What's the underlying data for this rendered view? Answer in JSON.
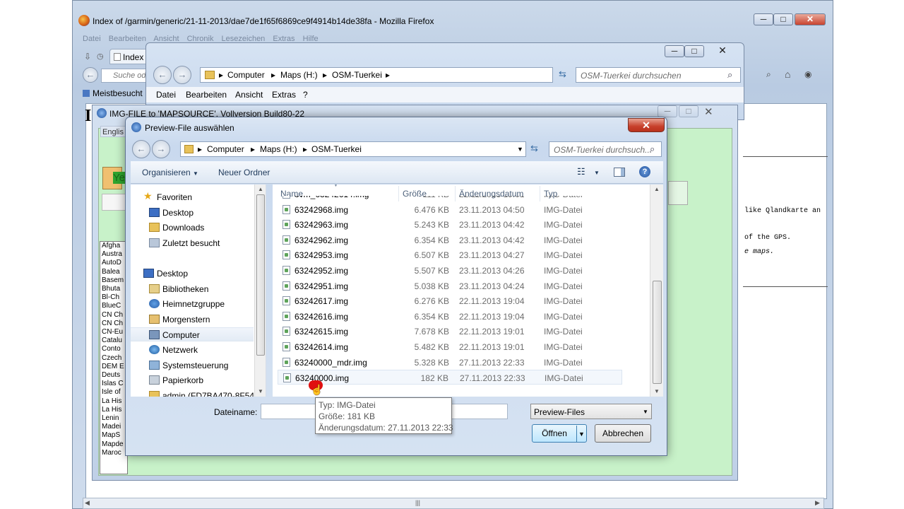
{
  "firefox": {
    "title": "Index of /garmin/generic/21-11-2013/dae7de1f65f6869ce9f4914b14de38fa - Mozilla Firefox",
    "menu": [
      "Datei",
      "Bearbeiten",
      "Ansicht",
      "Chronik",
      "Lesezeichen",
      "Extras",
      "Hilfe"
    ],
    "tab_label": "Index",
    "search_placeholder": "Suche od",
    "bookmark": "Meistbesucht",
    "page_heading_char": "I",
    "page_lines": [
      "like Qlandkarte an",
      "of the GPS.",
      "e maps."
    ]
  },
  "explorer": {
    "breadcrumb": [
      "Computer",
      "Maps (H:)",
      "OSM-Tuerkei"
    ],
    "search_placeholder": "OSM-Tuerkei durchsuchen",
    "menu": [
      "Datei",
      "Bearbeiten",
      "Ansicht",
      "Extras",
      "?"
    ]
  },
  "imgapp": {
    "title": "IMG-FILE to 'MAPSOURCE', Vollversion Build80-22",
    "tab": "Englis",
    "yes_label": "Ye",
    "countries": [
      "Afgha",
      "Austra",
      "AutoD",
      "Balea",
      "Basem",
      "Bhuta",
      "Bl-Ch",
      "BlueC",
      "CN Ch",
      "CN Ch",
      "CN-Eu",
      "Catalu",
      "Conto",
      "Czech",
      "DEM E",
      "Deuts",
      "Islas C",
      "Isle of",
      "La His",
      "La His",
      "Lenin",
      "Madei",
      "MapS",
      "Mapde",
      "Maroc"
    ]
  },
  "dialog": {
    "title": "Preview-File auswählen",
    "close_label": "✕",
    "breadcrumb": [
      "Computer",
      "Maps (H:)",
      "OSM-Tuerkei"
    ],
    "search_placeholder": "OSM-Tuerkei durchsuch...",
    "toolbar": {
      "organize": "Organisieren",
      "new_folder": "Neuer Ordner"
    },
    "nav": [
      {
        "label": "Favoriten",
        "icon": "star-icon"
      },
      {
        "label": "Desktop",
        "icon": "desktop-icon"
      },
      {
        "label": "Downloads",
        "icon": "downloads-icon"
      },
      {
        "label": "Zuletzt besucht",
        "icon": "recent-places-icon"
      },
      {
        "label": "Desktop",
        "icon": "desktop-icon"
      },
      {
        "label": "Bibliotheken",
        "icon": "libraries-icon"
      },
      {
        "label": "Heimnetzgruppe",
        "icon": "homegroup-icon"
      },
      {
        "label": "Morgenstern",
        "icon": "user-icon"
      },
      {
        "label": "Computer",
        "icon": "computer-icon"
      },
      {
        "label": "Netzwerk",
        "icon": "network-icon"
      },
      {
        "label": "Systemsteuerung",
        "icon": "control-panel-icon"
      },
      {
        "label": "Papierkorb",
        "icon": "recycle-bin-icon"
      },
      {
        "label": "admin (FD7BA470-8F54",
        "icon": "folder-icon"
      }
    ],
    "columns": {
      "name": "Name",
      "size": "Größe",
      "date": "Änderungsdatum",
      "type": "Typ"
    },
    "files": [
      {
        "name": "ovm_63242614.img",
        "size": "111 KB",
        "date": "22.11.2013 19:01",
        "type": "IMG-Datei"
      },
      {
        "name": "63242968.img",
        "size": "6.476 KB",
        "date": "23.11.2013 04:50",
        "type": "IMG-Datei"
      },
      {
        "name": "63242963.img",
        "size": "5.243 KB",
        "date": "23.11.2013 04:42",
        "type": "IMG-Datei"
      },
      {
        "name": "63242962.img",
        "size": "6.354 KB",
        "date": "23.11.2013 04:42",
        "type": "IMG-Datei"
      },
      {
        "name": "63242953.img",
        "size": "6.507 KB",
        "date": "23.11.2013 04:27",
        "type": "IMG-Datei"
      },
      {
        "name": "63242952.img",
        "size": "5.507 KB",
        "date": "23.11.2013 04:26",
        "type": "IMG-Datei"
      },
      {
        "name": "63242951.img",
        "size": "5.038 KB",
        "date": "23.11.2013 04:24",
        "type": "IMG-Datei"
      },
      {
        "name": "63242617.img",
        "size": "6.276 KB",
        "date": "22.11.2013 19:04",
        "type": "IMG-Datei"
      },
      {
        "name": "63242616.img",
        "size": "6.354 KB",
        "date": "22.11.2013 19:04",
        "type": "IMG-Datei"
      },
      {
        "name": "63242615.img",
        "size": "7.678 KB",
        "date": "22.11.2013 19:01",
        "type": "IMG-Datei"
      },
      {
        "name": "63242614.img",
        "size": "5.482 KB",
        "date": "22.11.2013 19:01",
        "type": "IMG-Datei"
      },
      {
        "name": "63240000_mdr.img",
        "size": "5.328 KB",
        "date": "27.11.2013 22:33",
        "type": "IMG-Datei"
      },
      {
        "name": "63240000.img",
        "size": "182 KB",
        "date": "27.11.2013 22:33",
        "type": "IMG-Datei"
      }
    ],
    "filename_label": "Dateiname:",
    "filename_value": "",
    "filter_value": "Preview-Files",
    "open_button": "Öffnen",
    "cancel_button": "Abbrechen"
  },
  "tooltip": {
    "line1": "Typ: IMG-Datei",
    "line2": "Größe: 181 KB",
    "line3": "Änderungsdatum: 27.11.2013 22:33"
  }
}
